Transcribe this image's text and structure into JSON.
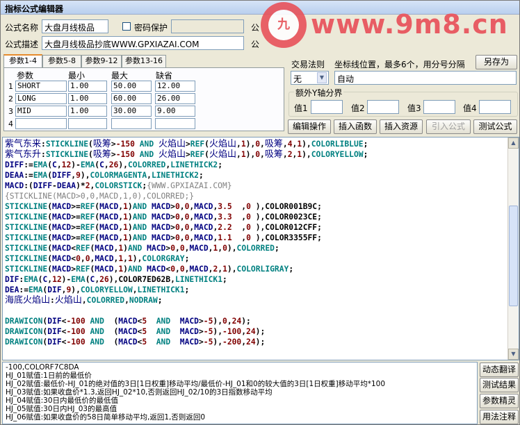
{
  "window": {
    "title": "指标公式编辑器"
  },
  "form": {
    "name_label": "公式名称",
    "name_value": "大盘月线极品",
    "password_label": "密码保护",
    "password_value": "",
    "desc_label": "公式描述",
    "desc_value": "大盘月线极品抄底WWW.GPXIAZAI.COM",
    "trade_rule_label": "交易法则",
    "trade_rule_value": "无",
    "coord_label": "坐标线位置，最多6个，用分号分隔",
    "coord_value": "自动",
    "extra_y_label": "额外Y轴分界",
    "value_labels": [
      "值1",
      "值2",
      "值3",
      "值4"
    ],
    "values": [
      "",
      "",
      "",
      ""
    ]
  },
  "side_labels": {
    "gongshi1": "公",
    "gongshi2": "公"
  },
  "buttons": {
    "save_as": "另存为",
    "edit_op": "编辑操作",
    "insert_func": "插入函数",
    "insert_res": "插入资源",
    "import_formula": "引入公式",
    "test_formula": "测试公式",
    "dynamic_translate": "动态翻译",
    "test_result": "测试结果",
    "param_wizard": "参数精灵",
    "usage_notes": "用法注释"
  },
  "tabs": [
    "参数1-4",
    "参数5-8",
    "参数9-12",
    "参数13-16"
  ],
  "params": {
    "headers": [
      "参数",
      "最小",
      "最大",
      "缺省"
    ],
    "rows": [
      {
        "idx": "1",
        "name": "SHORT",
        "min": "1.00",
        "max": "50.00",
        "def": "12.00"
      },
      {
        "idx": "2",
        "name": "LONG",
        "min": "1.00",
        "max": "60.00",
        "def": "26.00"
      },
      {
        "idx": "3",
        "name": "MID",
        "min": "1.00",
        "max": "30.00",
        "def": "9.00"
      },
      {
        "idx": "4",
        "name": "",
        "min": "",
        "max": "",
        "def": ""
      }
    ]
  },
  "output": {
    "lines": [
      "-100,COLORF7C8DA",
      "HJ_01赋值:1日前的最低价",
      "HJ_02赋值:最低价-HJ_01的绝对值的3日[1日权重]移动平均/最低价-HJ_01和0的较大值的3日[1日权重]移动平均*100",
      "HJ_03赋值:如果收盘价*1.3,返回HJ_02*10,否则返回HJ_02/10的3日指数移动平均",
      "HJ_04赋值:30日内最低价的最低值",
      "HJ_05赋值:30日内HJ_03的最高值",
      "HJ_06赋值:如果收盘价的58日简单移动平均,返回1,否则返回0"
    ]
  },
  "watermark": {
    "badge_text": "九",
    "site_text": "www.9m8.cn"
  },
  "icons": {
    "scroll_up": "▲",
    "scroll_down": "▼",
    "dropdown": "▼"
  },
  "colors": {
    "accent_tab": "#e68b2c",
    "watermark": "#e85d64"
  }
}
